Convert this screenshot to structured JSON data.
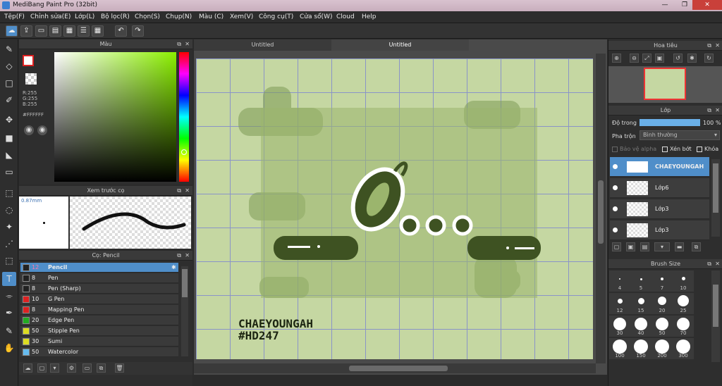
{
  "window": {
    "title": "MediBang Paint Pro (32bit)",
    "min": "—",
    "max": "❐",
    "close": "✕"
  },
  "menu": [
    "Tệp(F)",
    "Chỉnh sửa(E)",
    "Lớp(L)",
    "Bộ lọc(R)",
    "Chọn(S)",
    "Chụp(N)",
    "Màu (C)",
    "Xem(V)",
    "Công cụ(T)",
    "Cửa sổ(W)",
    "Cloud",
    "Help"
  ],
  "color_panel": {
    "title": "Màu",
    "r": "R:255",
    "g": "G:255",
    "b": "B:255",
    "hex": "#FFFFFF"
  },
  "brush_preview": {
    "title": "Xem trước cọ",
    "size": "0.87mm"
  },
  "brush_panel": {
    "title": "Cọ: Pencil",
    "items": [
      {
        "size": "12",
        "name": "Pencil",
        "color": "#222222"
      },
      {
        "size": "8",
        "name": "Pen",
        "color": "#222222"
      },
      {
        "size": "8",
        "name": "Pen (Sharp)",
        "color": "#222222"
      },
      {
        "size": "10",
        "name": "G Pen",
        "color": "#dd2222"
      },
      {
        "size": "8",
        "name": "Mapping Pen",
        "color": "#dd2222"
      },
      {
        "size": "20",
        "name": "Edge Pen",
        "color": "#22aa22"
      },
      {
        "size": "50",
        "name": "Stipple Pen",
        "color": "#dddd22"
      },
      {
        "size": "30",
        "name": "Sumi",
        "color": "#dddd22"
      },
      {
        "size": "50",
        "name": "Watercolor",
        "color": "#66bbee"
      }
    ]
  },
  "tabs": [
    "Untitled",
    "Untitled"
  ],
  "artwork": {
    "exclaim": "Ở...",
    "sig1": "CHAEYOUNGAH",
    "sig2": "#HD247"
  },
  "navigator": {
    "title": "Hoa tiêu"
  },
  "layer_panel": {
    "title": "Lớp",
    "opacity_label": "Độ trong",
    "opacity_value": "100 %",
    "blend_label": "Pha trộn",
    "blend_value": "Bình thường",
    "protect": "Bảo vệ alpha",
    "clip": "Xén bớt",
    "lock": "Khóa",
    "layers": [
      "CHAEYOUNGAH",
      "Lớp6",
      "Lớp3",
      "Lớp3"
    ]
  },
  "brush_size": {
    "title": "Brush Size",
    "sizes": [
      "4",
      "5",
      "7",
      "10",
      "12",
      "15",
      "20",
      "25",
      "30",
      "40",
      "50",
      "70",
      "100",
      "150",
      "200",
      "300"
    ]
  },
  "colors": {
    "accent": "#4f8ec9",
    "canvas": "#c5d7a2",
    "dark": "#3e5222"
  }
}
